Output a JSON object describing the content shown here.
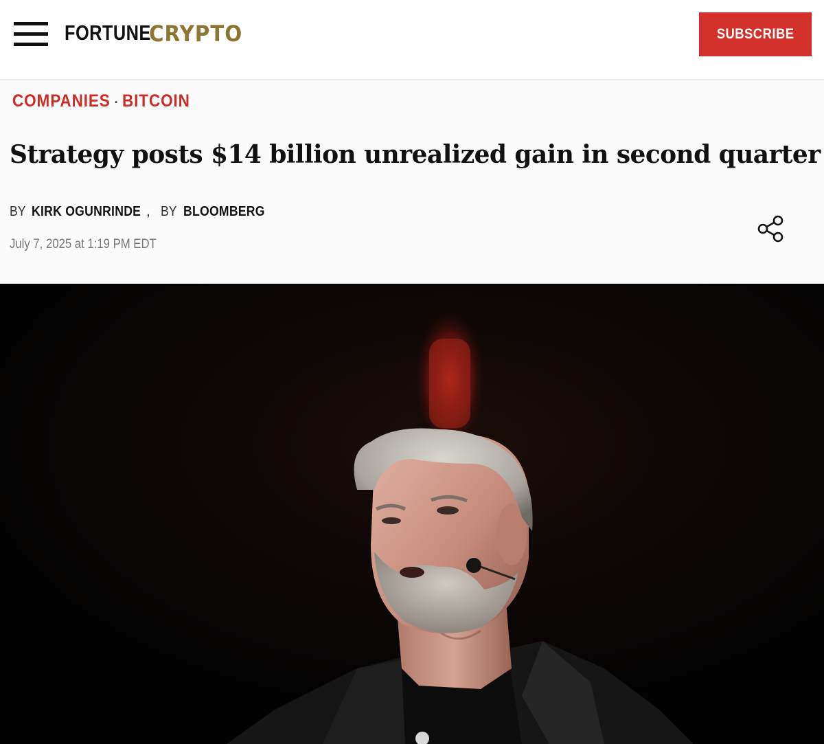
{
  "header": {
    "logo": {
      "part1": "FORTUNE",
      "part2": "CRYPTO"
    },
    "subscribe_label": "SUBSCRIBE"
  },
  "article": {
    "breadcrumb": [
      {
        "label": "COMPANIES"
      },
      {
        "label": "BITCOIN"
      }
    ],
    "breadcrumb_separator": "·",
    "headline": "Strategy posts $14 billion unrealized gain in second quarter",
    "byline": {
      "prefix": "BY",
      "authors": [
        "KIRK OGUNRINDE",
        "BLOOMBERG"
      ],
      "separator": ","
    },
    "date": "July 7, 2025 at 1:19 PM EDT"
  },
  "colors": {
    "brand_red": "#d1302b",
    "brand_gold": "#8c7632",
    "text_dark": "#111111",
    "meta_gray": "#777777"
  },
  "icons": {
    "menu": "hamburger-icon",
    "share": "share-icon"
  }
}
